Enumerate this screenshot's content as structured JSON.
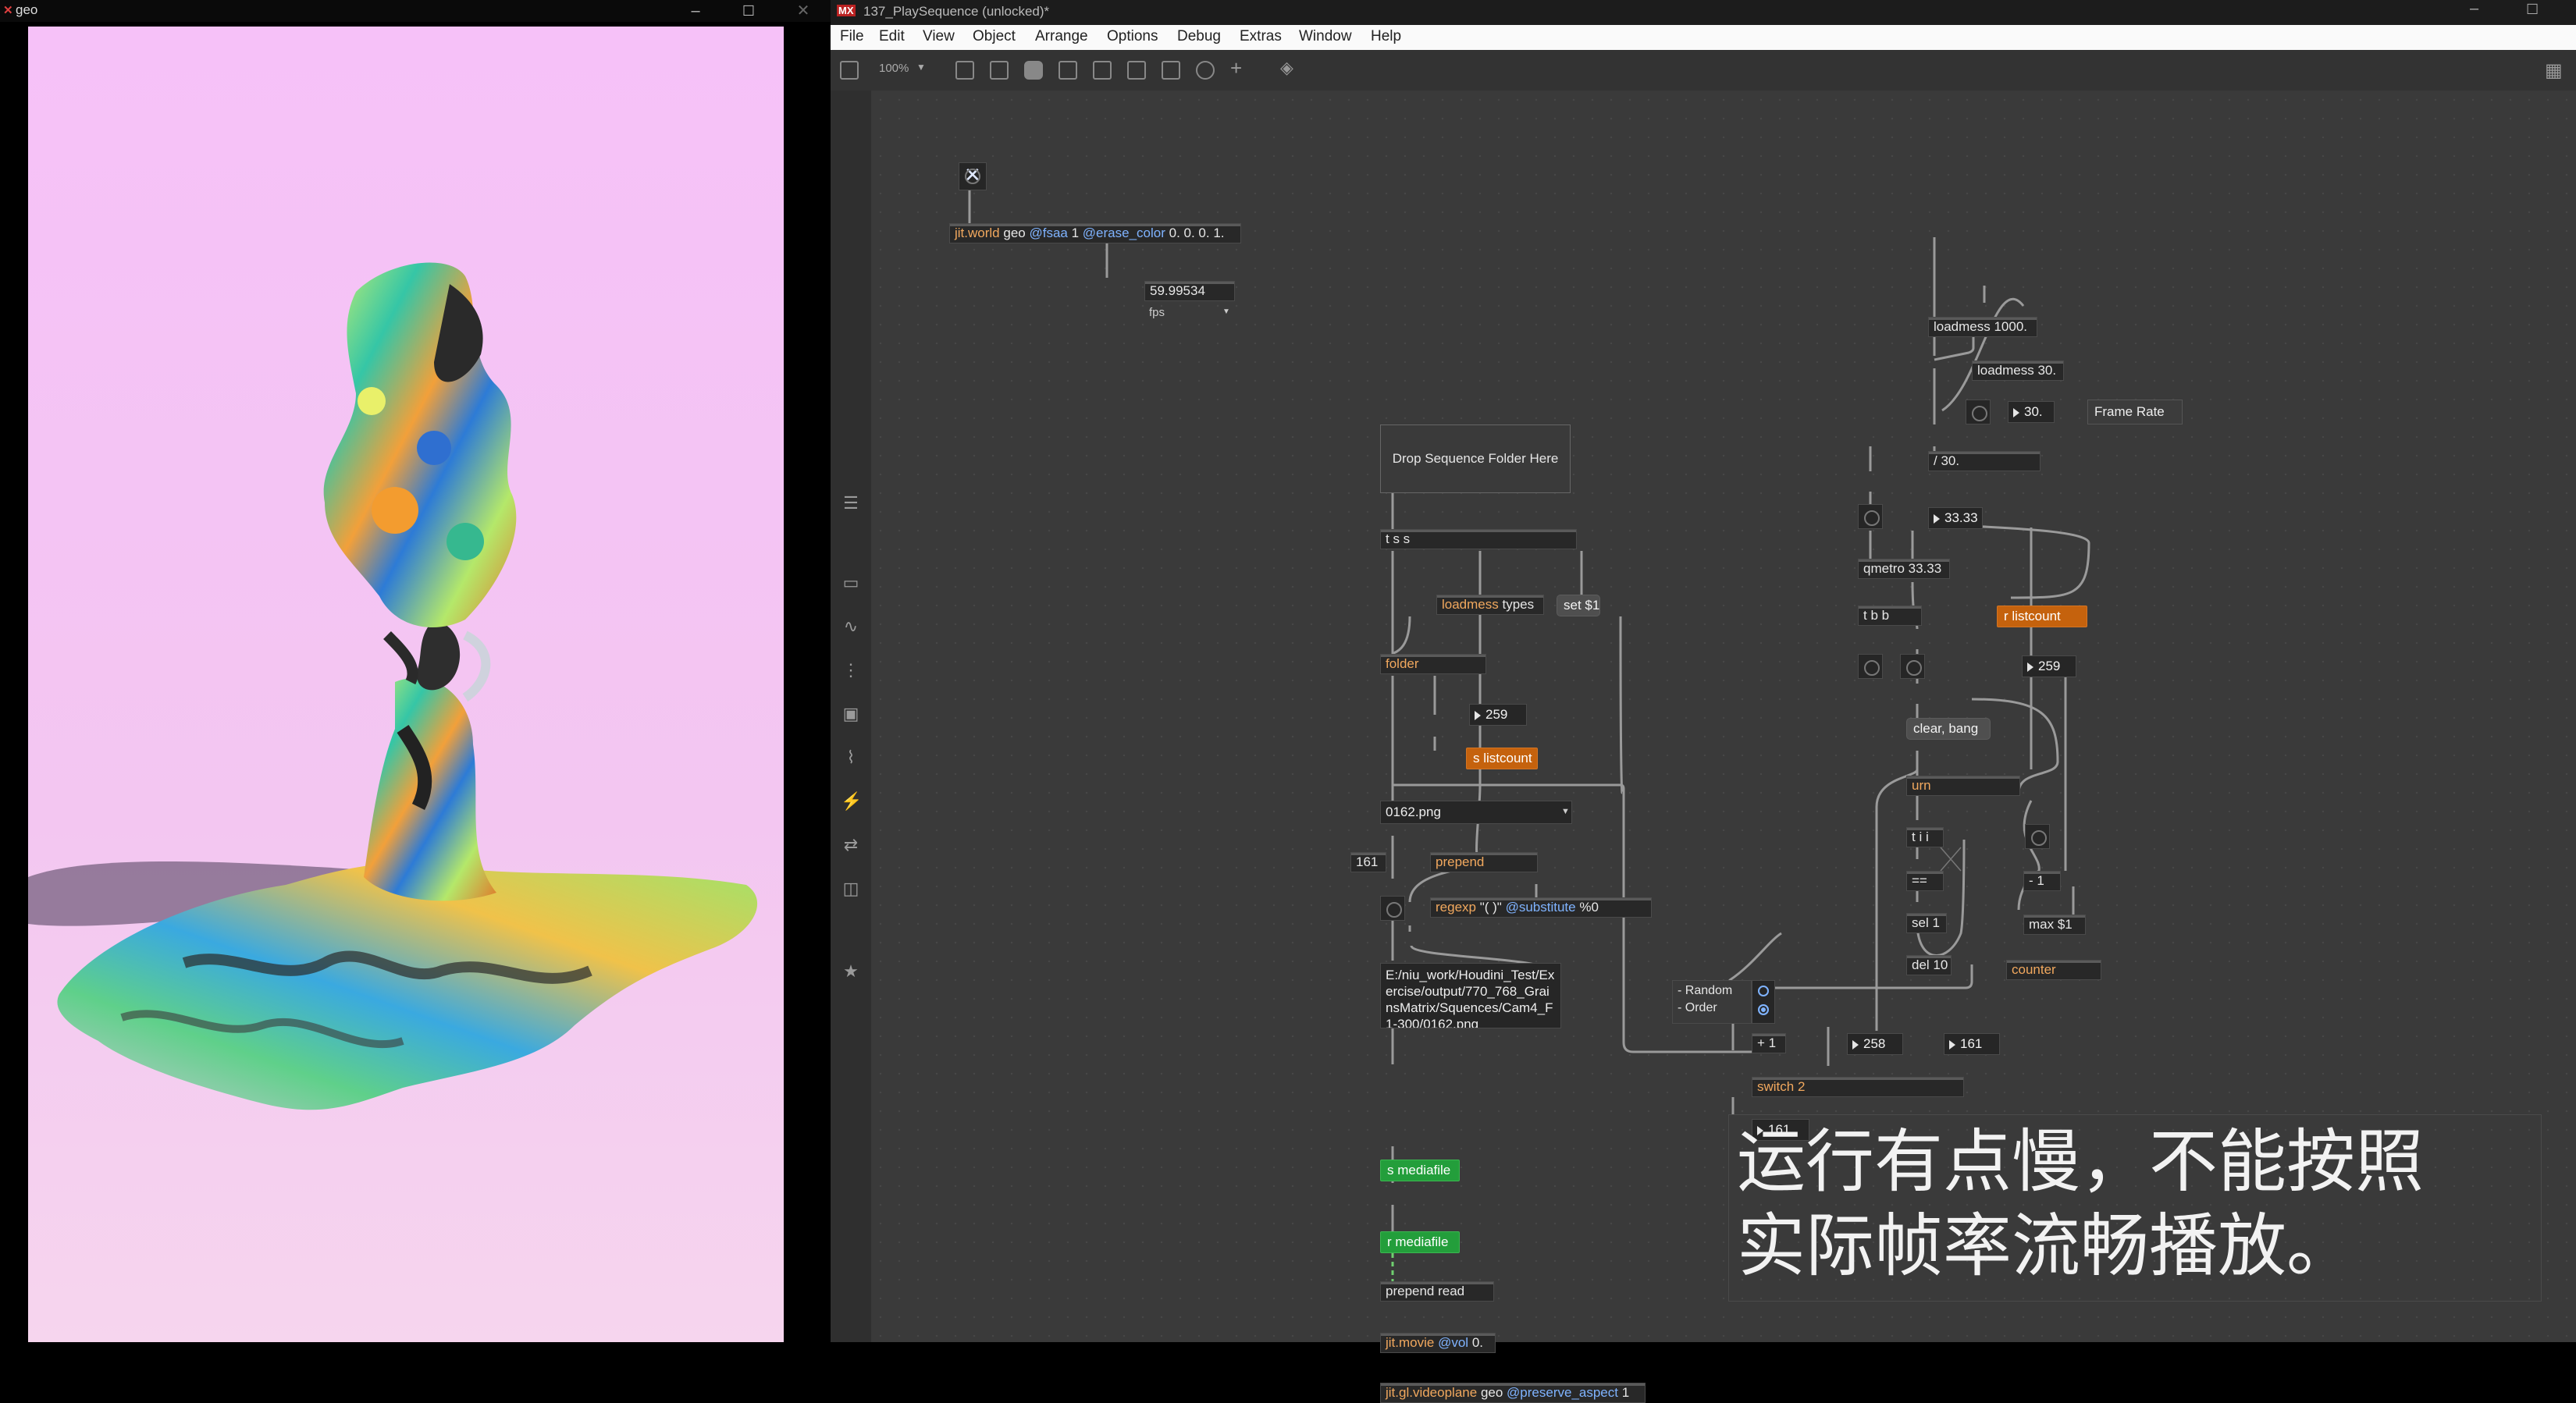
{
  "geo_window": {
    "title": "geo",
    "title_icon": "max-x-icon",
    "controls": [
      "minimize-icon",
      "maximize-icon",
      "close-icon"
    ]
  },
  "max_window": {
    "title": "137_PlaySequence (unlocked)*",
    "title_icon": "max-logo-icon",
    "menu": [
      "File",
      "Edit",
      "View",
      "Object",
      "Arrange",
      "Options",
      "Debug",
      "Extras",
      "Window",
      "Help"
    ],
    "zoom": "100%"
  },
  "patch": {
    "toggle_icon": "toggle-x-icon",
    "jit_world": {
      "name": "jit.world",
      "args": "geo",
      "attr1": "@fsaa",
      "val1": "1",
      "attr2": "@erase_color",
      "val2": "0. 0. 0. 1."
    },
    "fps_value": "59.99534",
    "fps_menu": "fps",
    "drop_folder": "Drop Sequence Folder Here",
    "tss": "t s s",
    "loadmess_types": {
      "name": "loadmess",
      "arg": "types"
    },
    "set_msg": "set $1",
    "folder": "folder",
    "num_259a": "259",
    "s_listcount": "s listcount",
    "umenu_value": "0162.png",
    "num_161a": "161",
    "prepend": "prepend",
    "regexp": {
      "name": "regexp",
      "arg1": "\"( )\"",
      "attr": "@substitute",
      "val": "%0"
    },
    "path_text": "E:/niu_work/Houdini_Test/Exercise/output/770_768_GrainsMatrix/Squences/Cam4_F1-300/0162.png",
    "s_mediafile": "s mediafile",
    "r_mediafile": "r mediafile",
    "prepend_read": "prepend read",
    "jit_movie": {
      "name": "jit.movie",
      "attr": "@vol",
      "val": "0."
    },
    "videoplane": {
      "name": "jit.gl.videoplane",
      "args": "geo",
      "attr": "@preserve_aspect",
      "val": "1"
    },
    "loadmess_1000": "loadmess 1000.",
    "loadmess_30": "loadmess 30.",
    "num_30": "30.",
    "frame_rate": "Frame Rate",
    "div_30": "/ 30.",
    "num_3333": "33.33",
    "qmetro": "qmetro 33.33",
    "tbb": "t b b",
    "r_listcount": "r listcount",
    "num_259b": "259",
    "clear_bang": "clear, bang",
    "urn": "urn",
    "tii": "t i i",
    "eq": "==",
    "sel1": "sel 1",
    "del10": "del 10",
    "minus1": "- 1",
    "max1": "max $1",
    "counter": "counter",
    "radio_labels": [
      "- Random",
      "- Order"
    ],
    "plus1": "+ 1",
    "num_258": "258",
    "num_161b": "161",
    "switch2": "switch 2",
    "num_161c": "161",
    "note": [
      "运行有点慢，不能按照",
      "实际帧率流畅播放。"
    ]
  }
}
